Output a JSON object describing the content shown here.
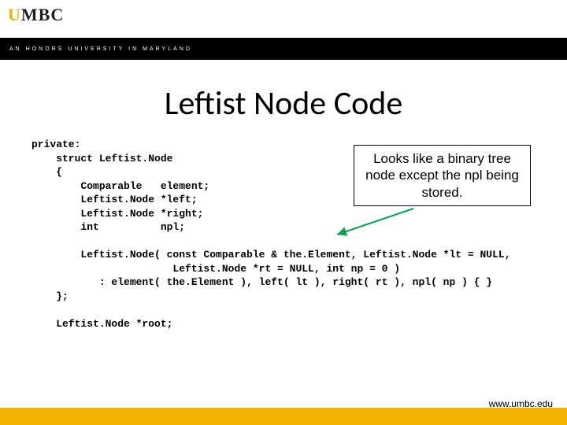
{
  "header": {
    "logo_prefix": "U",
    "logo_rest": "MBC",
    "tagline": "AN  HONORS  UNIVERSITY  IN  MARYLAND"
  },
  "title": "Leftist Node Code",
  "annotation": "Looks like a binary tree node except the npl being stored.",
  "code": "private:\n    struct Leftist.Node\n    {\n        Comparable   element;\n        Leftist.Node *left;\n        Leftist.Node *right;\n        int          npl;\n\n        Leftist.Node( const Comparable & the.Element, Leftist.Node *lt = NULL,\n                       Leftist.Node *rt = NULL, int np = 0 )\n           : element( the.Element ), left( lt ), right( rt ), npl( np ) { }\n    };\n\n    Leftist.Node *root;",
  "footer": {
    "url": "www.umbc.edu"
  }
}
